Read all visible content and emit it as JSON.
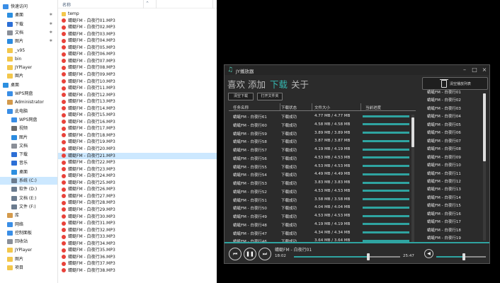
{
  "explorer": {
    "nav_items": [
      {
        "label": "快速访问",
        "icon": "star-icon",
        "color": "#3a8ee6",
        "pin": false,
        "indent": 4
      },
      {
        "label": "桌面",
        "icon": "desktop-icon",
        "color": "#2c8fe0",
        "pin": true,
        "indent": 10
      },
      {
        "label": "下载",
        "icon": "download-icon",
        "color": "#2c6fd6",
        "pin": true,
        "indent": 10
      },
      {
        "label": "文档",
        "icon": "document-icon",
        "color": "#8a8f98",
        "pin": true,
        "indent": 10
      },
      {
        "label": "图片",
        "icon": "picture-icon",
        "color": "#2b8be0",
        "pin": true,
        "indent": 10
      },
      {
        "label": "_v95",
        "icon": "folder-icon",
        "color": "#f3c74b",
        "pin": false,
        "indent": 10
      },
      {
        "label": "bin",
        "icon": "folder-icon",
        "color": "#f3c74b",
        "pin": false,
        "indent": 10
      },
      {
        "label": "JYPlayer",
        "icon": "folder-icon",
        "color": "#f3c74b",
        "pin": false,
        "indent": 10
      },
      {
        "label": "图片",
        "icon": "folder-icon",
        "color": "#f3c74b",
        "pin": false,
        "indent": 10
      },
      {
        "label": "桌面",
        "icon": "desktop-icon",
        "color": "#2c8fe0",
        "pin": false,
        "indent": 4
      },
      {
        "label": "WPS网盘",
        "icon": "cloud-icon",
        "color": "#3a8ee6",
        "pin": false,
        "indent": 10
      },
      {
        "label": "Administrator",
        "icon": "user-icon",
        "color": "#d49a4c",
        "pin": false,
        "indent": 10
      },
      {
        "label": "此电脑",
        "icon": "computer-icon",
        "color": "#3a8ee6",
        "pin": false,
        "indent": 10
      },
      {
        "label": "WPS网盘",
        "icon": "cloud-icon",
        "color": "#3a8ee6",
        "pin": false,
        "indent": 16
      },
      {
        "label": "视频",
        "icon": "video-icon",
        "color": "#6b6b6b",
        "pin": false,
        "indent": 16
      },
      {
        "label": "图片",
        "icon": "picture-icon",
        "color": "#2b8be0",
        "pin": false,
        "indent": 16
      },
      {
        "label": "文档",
        "icon": "document-icon",
        "color": "#8a8f98",
        "pin": false,
        "indent": 16
      },
      {
        "label": "下载",
        "icon": "download-icon",
        "color": "#2c6fd6",
        "pin": false,
        "indent": 16
      },
      {
        "label": "音乐",
        "icon": "music-icon",
        "color": "#2c6fd6",
        "pin": false,
        "indent": 16
      },
      {
        "label": "桌面",
        "icon": "desktop-icon",
        "color": "#2c8fe0",
        "pin": false,
        "indent": 16
      },
      {
        "label": "系统 (C:)",
        "icon": "drive-icon",
        "color": "#6b7c8f",
        "pin": false,
        "indent": 16,
        "selected": true
      },
      {
        "label": "软件 (D:)",
        "icon": "drive-icon",
        "color": "#6b7c8f",
        "pin": false,
        "indent": 16
      },
      {
        "label": "文档 (E:)",
        "icon": "drive-icon",
        "color": "#6b7c8f",
        "pin": false,
        "indent": 16
      },
      {
        "label": "文件 (F:)",
        "icon": "drive-icon",
        "color": "#6b7c8f",
        "pin": false,
        "indent": 16
      },
      {
        "label": "库",
        "icon": "library-icon",
        "color": "#d49a4c",
        "pin": false,
        "indent": 10
      },
      {
        "label": "网络",
        "icon": "network-icon",
        "color": "#3a8ee6",
        "pin": false,
        "indent": 10
      },
      {
        "label": "控制面板",
        "icon": "control-panel-icon",
        "color": "#3a8ee6",
        "pin": false,
        "indent": 10
      },
      {
        "label": "回收站",
        "icon": "recycle-bin-icon",
        "color": "#8a8f98",
        "pin": false,
        "indent": 10
      },
      {
        "label": "JYPlayer",
        "icon": "folder-icon",
        "color": "#f3c74b",
        "pin": false,
        "indent": 10
      },
      {
        "label": "图片",
        "icon": "folder-icon",
        "color": "#f3c74b",
        "pin": false,
        "indent": 10
      },
      {
        "label": "项目",
        "icon": "folder-icon",
        "color": "#f3c74b",
        "pin": false,
        "indent": 10
      }
    ],
    "column_header": "名称",
    "files": [
      {
        "name": "temp",
        "type": "folder"
      },
      {
        "name": "蜻蜓FM - 白夜行01.MP3",
        "type": "mp3"
      },
      {
        "name": "蜻蜓FM - 白夜行02.MP3",
        "type": "mp3"
      },
      {
        "name": "蜻蜓FM - 白夜行03.MP3",
        "type": "mp3"
      },
      {
        "name": "蜻蜓FM - 白夜行04.MP3",
        "type": "mp3"
      },
      {
        "name": "蜻蜓FM - 白夜行05.MP3",
        "type": "mp3"
      },
      {
        "name": "蜻蜓FM - 白夜行06.MP3",
        "type": "mp3"
      },
      {
        "name": "蜻蜓FM - 白夜行07.MP3",
        "type": "mp3"
      },
      {
        "name": "蜻蜓FM - 白夜行08.MP3",
        "type": "mp3"
      },
      {
        "name": "蜻蜓FM - 白夜行09.MP3",
        "type": "mp3"
      },
      {
        "name": "蜻蜓FM - 白夜行10.MP3",
        "type": "mp3"
      },
      {
        "name": "蜻蜓FM - 白夜行11.MP3",
        "type": "mp3"
      },
      {
        "name": "蜻蜓FM - 白夜行12.MP3",
        "type": "mp3"
      },
      {
        "name": "蜻蜓FM - 白夜行13.MP3",
        "type": "mp3"
      },
      {
        "name": "蜻蜓FM - 白夜行14.MP3",
        "type": "mp3"
      },
      {
        "name": "蜻蜓FM - 白夜行15.MP3",
        "type": "mp3"
      },
      {
        "name": "蜻蜓FM - 白夜行16.MP3",
        "type": "mp3"
      },
      {
        "name": "蜻蜓FM - 白夜行17.MP3",
        "type": "mp3"
      },
      {
        "name": "蜻蜓FM - 白夜行18.MP3",
        "type": "mp3"
      },
      {
        "name": "蜻蜓FM - 白夜行19.MP3",
        "type": "mp3"
      },
      {
        "name": "蜻蜓FM - 白夜行20.MP3",
        "type": "mp3"
      },
      {
        "name": "蜻蜓FM - 白夜行21.MP3",
        "type": "mp3",
        "selected": true
      },
      {
        "name": "蜻蜓FM - 白夜行22.MP3",
        "type": "mp3"
      },
      {
        "name": "蜻蜓FM - 白夜行23.MP3",
        "type": "mp3"
      },
      {
        "name": "蜻蜓FM - 白夜行24.MP3",
        "type": "mp3"
      },
      {
        "name": "蜻蜓FM - 白夜行25.MP3",
        "type": "mp3"
      },
      {
        "name": "蜻蜓FM - 白夜行26.MP3",
        "type": "mp3"
      },
      {
        "name": "蜻蜓FM - 白夜行27.MP3",
        "type": "mp3"
      },
      {
        "name": "蜻蜓FM - 白夜行28.MP3",
        "type": "mp3"
      },
      {
        "name": "蜻蜓FM - 白夜行29.MP3",
        "type": "mp3"
      },
      {
        "name": "蜻蜓FM - 白夜行30.MP3",
        "type": "mp3"
      },
      {
        "name": "蜻蜓FM - 白夜行31.MP3",
        "type": "mp3"
      },
      {
        "name": "蜻蜓FM - 白夜行32.MP3",
        "type": "mp3"
      },
      {
        "name": "蜻蜓FM - 白夜行33.MP3",
        "type": "mp3"
      },
      {
        "name": "蜻蜓FM - 白夜行34.MP3",
        "type": "mp3"
      },
      {
        "name": "蜻蜓FM - 白夜行35.MP3",
        "type": "mp3"
      },
      {
        "name": "蜻蜓FM - 白夜行36.MP3",
        "type": "mp3"
      },
      {
        "name": "蜻蜓FM - 白夜行37.MP3",
        "type": "mp3"
      },
      {
        "name": "蜻蜓FM - 白夜行38.MP3",
        "type": "mp3"
      }
    ]
  },
  "player": {
    "title": "JY播放器",
    "tabs": [
      "喜欢",
      "添加",
      "下载",
      "关于"
    ],
    "active_tab": 2,
    "clear_playlist_label": "清空播放列表",
    "clear_downloads_label": "清空下载",
    "open_folder_label": "打开文件夹",
    "headers": [
      "任务名称",
      "下载状态",
      "文件大小",
      "当前进度"
    ],
    "downloads": [
      {
        "name": "蜻蜓FM - 白夜行61",
        "status": "下载成功",
        "size": "4.77 MB / 4.77 MB",
        "progress": 1.0
      },
      {
        "name": "蜻蜓FM - 白夜行60",
        "status": "下载成功",
        "size": "4.58 MB / 4.58 MB",
        "progress": 1.0
      },
      {
        "name": "蜻蜓FM - 白夜行59",
        "status": "下载成功",
        "size": "3.89 MB / 3.89 MB",
        "progress": 1.0
      },
      {
        "name": "蜻蜓FM - 白夜行58",
        "status": "下载成功",
        "size": "3.87 MB / 3.87 MB",
        "progress": 1.0
      },
      {
        "name": "蜻蜓FM - 白夜行57",
        "status": "下载成功",
        "size": "4.19 MB / 4.19 MB",
        "progress": 1.0
      },
      {
        "name": "蜻蜓FM - 白夜行56",
        "status": "下载成功",
        "size": "4.53 MB / 4.53 MB",
        "progress": 1.0
      },
      {
        "name": "蜻蜓FM - 白夜行55",
        "status": "下载成功",
        "size": "4.53 MB / 4.53 MB",
        "progress": 1.0
      },
      {
        "name": "蜻蜓FM - 白夜行54",
        "status": "下载成功",
        "size": "4.49 MB / 4.49 MB",
        "progress": 1.0
      },
      {
        "name": "蜻蜓FM - 白夜行53",
        "status": "下载成功",
        "size": "3.83 MB / 3.83 MB",
        "progress": 1.0
      },
      {
        "name": "蜻蜓FM - 白夜行52",
        "status": "下载成功",
        "size": "4.53 MB / 4.53 MB",
        "progress": 1.0
      },
      {
        "name": "蜻蜓FM - 白夜行51",
        "status": "下载成功",
        "size": "3.58 MB / 3.58 MB",
        "progress": 1.0
      },
      {
        "name": "蜻蜓FM - 白夜行50",
        "status": "下载成功",
        "size": "4.04 MB / 4.04 MB",
        "progress": 1.0
      },
      {
        "name": "蜻蜓FM - 白夜行49",
        "status": "下载成功",
        "size": "4.53 MB / 4.53 MB",
        "progress": 1.0
      },
      {
        "name": "蜻蜓FM - 白夜行48",
        "status": "下载成功",
        "size": "4.19 MB / 4.19 MB",
        "progress": 1.0
      },
      {
        "name": "蜻蜓FM - 白夜行47",
        "status": "下载成功",
        "size": "4.34 MB / 4.34 MB",
        "progress": 1.0
      },
      {
        "name": "蜻蜓FM - 白夜行46",
        "status": "下载成功",
        "size": "3.64 MB / 3.64 MB",
        "progress": 1.0
      }
    ],
    "playlist": [
      "蜻蜓FM - 白夜行01",
      "蜻蜓FM - 白夜行02",
      "蜻蜓FM - 白夜行03",
      "蜻蜓FM - 白夜行04",
      "蜻蜓FM - 白夜行05",
      "蜻蜓FM - 白夜行06",
      "蜻蜓FM - 白夜行07",
      "蜻蜓FM - 白夜行08",
      "蜻蜓FM - 白夜行09",
      "蜻蜓FM - 白夜行10",
      "蜻蜓FM - 白夜行11",
      "蜻蜓FM - 白夜行12",
      "蜻蜓FM - 白夜行13",
      "蜻蜓FM - 白夜行14",
      "蜻蜓FM - 白夜行15",
      "蜻蜓FM - 白夜行16",
      "蜻蜓FM - 白夜行17",
      "蜻蜓FM - 白夜行18",
      "蜻蜓FM - 白夜行19"
    ],
    "now_playing": "蜻蜓FM - 白夜行01",
    "current_time": "18:02",
    "total_time": "25:47",
    "seek_fraction": 0.7,
    "volume_fraction": 0.55,
    "accent_color": "#2fa4a1",
    "tab_active_color": "#35b7b0"
  }
}
